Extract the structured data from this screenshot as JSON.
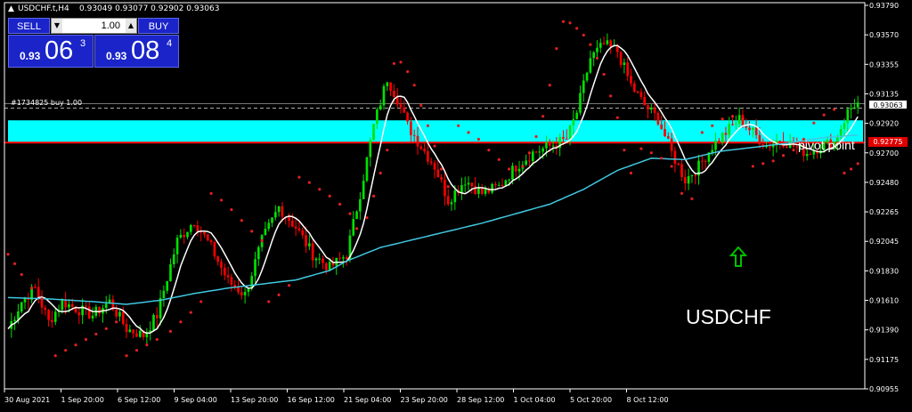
{
  "header": {
    "symbol_tf": "USDCHF.t,H4",
    "ohlc": "0.93049 0.93077 0.92902 0.93063"
  },
  "trade_panel": {
    "sell_label": "SELL",
    "buy_label": "BUY",
    "lot_value": "1.00",
    "sell_quote": {
      "prefix": "0.93",
      "big": "06",
      "sup": "3"
    },
    "buy_quote": {
      "prefix": "0.93",
      "big": "08",
      "sup": "4"
    }
  },
  "labels": {
    "order_line": "#1734825 buy 1.00",
    "pivot": "pivot point",
    "symbol": "USDCHF",
    "current_price": "0.93063",
    "pivot_price": "0.92775"
  },
  "colors": {
    "background": "#000000",
    "bull_candle": "#00e000",
    "bear_candle": "#ff0000",
    "ma_fast": "#ffffff",
    "ma_slow": "#40c8e0",
    "sar_dots": "#e02020",
    "zone_fill": "#00ffff",
    "pivot_line": "#ff0000",
    "arrow": "#00c000"
  },
  "icons": {
    "trend_arrow": "up-arrow-icon"
  },
  "chart_data": {
    "type": "candlestick",
    "ylim": [
      0.90955,
      0.9379
    ],
    "y_ticks": [
      "0.93790",
      "0.93570",
      "0.93355",
      "0.93135",
      "0.92920",
      "0.92700",
      "0.92480",
      "0.92265",
      "0.92045",
      "0.91830",
      "0.91610",
      "0.91390",
      "0.91175",
      "0.90955"
    ],
    "x_ticks": [
      "30 Aug 2021",
      "1 Sep 20:00",
      "6 Sep 12:00",
      "9 Sep 04:00",
      "13 Sep 20:00",
      "16 Sep 12:00",
      "21 Sep 04:00",
      "23 Sep 20:00",
      "28 Sep 12:00",
      "1 Oct 04:00",
      "5 Oct 20:00",
      "8 Oct 12:00"
    ],
    "zone": [
      0.9278,
      0.9294
    ],
    "pivot": 0.92775,
    "current": 0.93063,
    "anchors": [
      [
        0,
        0.914
      ],
      [
        4,
        0.916
      ],
      [
        8,
        0.917
      ],
      [
        12,
        0.9145
      ],
      [
        16,
        0.916
      ],
      [
        20,
        0.9155
      ],
      [
        25,
        0.915
      ],
      [
        30,
        0.916
      ],
      [
        35,
        0.914
      ],
      [
        40,
        0.9135
      ],
      [
        44,
        0.915
      ],
      [
        50,
        0.9205
      ],
      [
        55,
        0.922
      ],
      [
        60,
        0.92
      ],
      [
        65,
        0.9175
      ],
      [
        70,
        0.9165
      ],
      [
        75,
        0.9205
      ],
      [
        80,
        0.923
      ],
      [
        85,
        0.9215
      ],
      [
        90,
        0.9195
      ],
      [
        95,
        0.9185
      ],
      [
        100,
        0.9195
      ],
      [
        104,
        0.924
      ],
      [
        108,
        0.929
      ],
      [
        112,
        0.9325
      ],
      [
        115,
        0.931
      ],
      [
        118,
        0.929
      ],
      [
        122,
        0.9275
      ],
      [
        126,
        0.926
      ],
      [
        130,
        0.9235
      ],
      [
        135,
        0.925
      ],
      [
        140,
        0.924
      ],
      [
        145,
        0.9245
      ],
      [
        150,
        0.926
      ],
      [
        155,
        0.927
      ],
      [
        160,
        0.9275
      ],
      [
        165,
        0.928
      ],
      [
        168,
        0.93
      ],
      [
        172,
        0.934
      ],
      [
        176,
        0.935
      ],
      [
        180,
        0.9345
      ],
      [
        184,
        0.932
      ],
      [
        188,
        0.9305
      ],
      [
        192,
        0.9295
      ],
      [
        196,
        0.927
      ],
      [
        200,
        0.925
      ],
      [
        204,
        0.926
      ],
      [
        208,
        0.9275
      ],
      [
        212,
        0.9285
      ],
      [
        216,
        0.9295
      ],
      [
        220,
        0.9285
      ],
      [
        224,
        0.9275
      ],
      [
        228,
        0.928
      ],
      [
        232,
        0.9275
      ],
      [
        236,
        0.927
      ],
      [
        240,
        0.9275
      ],
      [
        244,
        0.9278
      ],
      [
        248,
        0.93
      ],
      [
        250,
        0.9306
      ]
    ],
    "slow_ma": [
      [
        0,
        0.9163
      ],
      [
        12,
        0.9162
      ],
      [
        25,
        0.916
      ],
      [
        35,
        0.9158
      ],
      [
        45,
        0.9161
      ],
      [
        55,
        0.9166
      ],
      [
        65,
        0.917
      ],
      [
        75,
        0.9173
      ],
      [
        85,
        0.9176
      ],
      [
        95,
        0.9183
      ],
      [
        100,
        0.919
      ],
      [
        110,
        0.92
      ],
      [
        120,
        0.9206
      ],
      [
        130,
        0.9212
      ],
      [
        140,
        0.9218
      ],
      [
        150,
        0.9225
      ],
      [
        160,
        0.9232
      ],
      [
        170,
        0.9243
      ],
      [
        180,
        0.9257
      ],
      [
        190,
        0.9266
      ],
      [
        200,
        0.9265
      ],
      [
        210,
        0.9271
      ],
      [
        220,
        0.9274
      ],
      [
        230,
        0.9277
      ],
      [
        240,
        0.9281
      ],
      [
        250,
        0.9283
      ]
    ],
    "sar_dots": [
      [
        0,
        0.9195
      ],
      [
        2,
        0.9188
      ],
      [
        4,
        0.918
      ],
      [
        7,
        0.917
      ],
      [
        10,
        0.9162
      ],
      [
        14,
        0.912
      ],
      [
        17,
        0.9124
      ],
      [
        20,
        0.9128
      ],
      [
        23,
        0.9132
      ],
      [
        26,
        0.9136
      ],
      [
        29,
        0.914
      ],
      [
        32,
        0.9145
      ],
      [
        35,
        0.912
      ],
      [
        38,
        0.9124
      ],
      [
        41,
        0.9128
      ],
      [
        44,
        0.9132
      ],
      [
        48,
        0.9138
      ],
      [
        51,
        0.9145
      ],
      [
        54,
        0.9152
      ],
      [
        57,
        0.916
      ],
      [
        60,
        0.924
      ],
      [
        63,
        0.9235
      ],
      [
        66,
        0.9228
      ],
      [
        69,
        0.922
      ],
      [
        72,
        0.9212
      ],
      [
        75,
        0.9205
      ],
      [
        77,
        0.916
      ],
      [
        80,
        0.9165
      ],
      [
        83,
        0.9172
      ],
      [
        86,
        0.9252
      ],
      [
        89,
        0.9248
      ],
      [
        92,
        0.9243
      ],
      [
        95,
        0.9238
      ],
      [
        98,
        0.9232
      ],
      [
        101,
        0.9225
      ],
      [
        103,
        0.9214
      ],
      [
        106,
        0.9222
      ],
      [
        108,
        0.9238
      ],
      [
        110,
        0.9255
      ],
      [
        112,
        0.9272
      ],
      [
        114,
        0.9336
      ],
      [
        116,
        0.9337
      ],
      [
        118,
        0.933
      ],
      [
        120,
        0.932
      ],
      [
        122,
        0.9305
      ],
      [
        124,
        0.929
      ],
      [
        126,
        0.9275
      ],
      [
        128,
        0.9258
      ],
      [
        130,
        0.9245
      ],
      [
        133,
        0.929
      ],
      [
        136,
        0.9285
      ],
      [
        139,
        0.928
      ],
      [
        142,
        0.9272
      ],
      [
        145,
        0.9265
      ],
      [
        148,
        0.9258
      ],
      [
        152,
        0.926
      ],
      [
        154,
        0.927
      ],
      [
        156,
        0.9282
      ],
      [
        158,
        0.9297
      ],
      [
        160,
        0.932
      ],
      [
        162,
        0.9347
      ],
      [
        164,
        0.9367
      ],
      [
        166,
        0.9366
      ],
      [
        168,
        0.9362
      ],
      [
        170,
        0.9357
      ],
      [
        172,
        0.935
      ],
      [
        174,
        0.934
      ],
      [
        176,
        0.9328
      ],
      [
        178,
        0.9312
      ],
      [
        180,
        0.9296
      ],
      [
        182,
        0.9272
      ],
      [
        184,
        0.9255
      ],
      [
        187,
        0.9273
      ],
      [
        190,
        0.927
      ],
      [
        193,
        0.9266
      ],
      [
        196,
        0.926
      ],
      [
        199,
        0.924
      ],
      [
        202,
        0.9236
      ],
      [
        205,
        0.9285
      ],
      [
        208,
        0.929
      ],
      [
        211,
        0.9295
      ],
      [
        214,
        0.9297
      ],
      [
        217,
        0.9295
      ],
      [
        220,
        0.926
      ],
      [
        223,
        0.9262
      ],
      [
        226,
        0.9264
      ],
      [
        229,
        0.9268
      ],
      [
        232,
        0.9272
      ],
      [
        235,
        0.928
      ],
      [
        238,
        0.9292
      ],
      [
        241,
        0.9298
      ],
      [
        244,
        0.9302
      ],
      [
        247,
        0.9255
      ],
      [
        249,
        0.9258
      ],
      [
        251,
        0.9262
      ]
    ]
  }
}
